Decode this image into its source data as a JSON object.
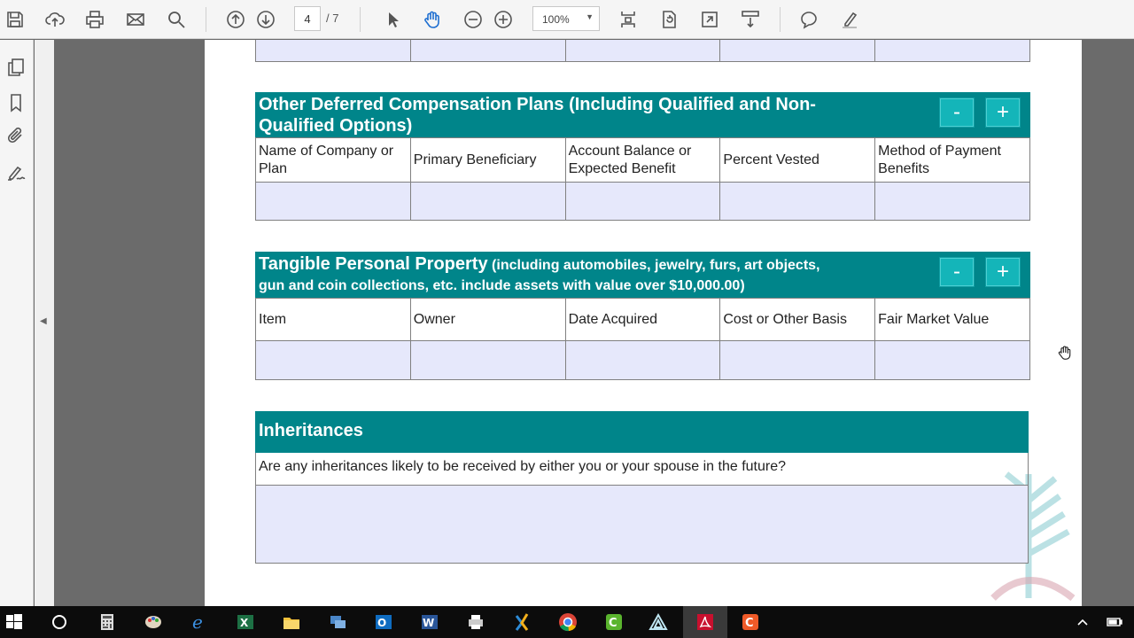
{
  "toolbar": {
    "icons": [
      "save-icon",
      "upload-icon",
      "print-icon",
      "email-icon",
      "search-icon",
      "page-up-icon",
      "page-down-icon",
      "select-cursor-icon",
      "hand-tool-icon",
      "zoom-out-icon",
      "zoom-in-icon",
      "fit-page-icon",
      "rotate-icon",
      "full-screen-icon",
      "scroll-mode-icon",
      "comment-icon",
      "highlight-icon"
    ],
    "page_current": "4",
    "page_total": "/ 7",
    "zoom": "100%"
  },
  "leftrail": {
    "icons": [
      "pages-icon",
      "bookmark-icon",
      "attachment-icon",
      "signature-icon"
    ]
  },
  "document": {
    "deferred": {
      "title_line1": "Other Deferred Compensation Plans (Including Qualified and Non-",
      "title_line2": "Qualified Options)",
      "minus": "-",
      "plus": "+",
      "headers": [
        {
          "l1": "Name of Company or",
          "l2": "Plan"
        },
        {
          "l1": "Primary Beneficiary",
          "l2": ""
        },
        {
          "l1": "Account Balance or",
          "l2": "Expected Benefit"
        },
        {
          "l1": "Percent Vested",
          "l2": ""
        },
        {
          "l1": "Method of Payment",
          "l2": "Benefits"
        }
      ]
    },
    "tangible": {
      "title_big": "Tangible Personal Property",
      "title_small1": "(including automobiles, jewelry, furs, art objects,",
      "title_small2": "gun and coin collections, etc. include assets with value over $10,000.00)",
      "minus": "-",
      "plus": "+",
      "headers": [
        "Item",
        "Owner",
        "Date Acquired",
        "Cost or Other Basis",
        "Fair Market Value"
      ]
    },
    "inheritances": {
      "title": "Inheritances",
      "question": "Are any inheritances likely to be received by either you or your spouse in the future?"
    }
  },
  "taskbar": {
    "apps": [
      "windows-start-icon",
      "cortana-icon",
      "calculator-icon",
      "paint-icon",
      "edge-icon",
      "excel-icon",
      "file-explorer-icon",
      "network-app-icon",
      "outlook-icon",
      "word-icon",
      "printer-app-icon",
      "xing-icon",
      "chrome-icon",
      "camtasia-icon",
      "delta-app-icon",
      "acrobat-icon",
      "camtasia-recorder-icon"
    ]
  },
  "colors": {
    "teal": "#00858a",
    "button": "#14b5b9",
    "field_fill": "#e6e8fb"
  }
}
